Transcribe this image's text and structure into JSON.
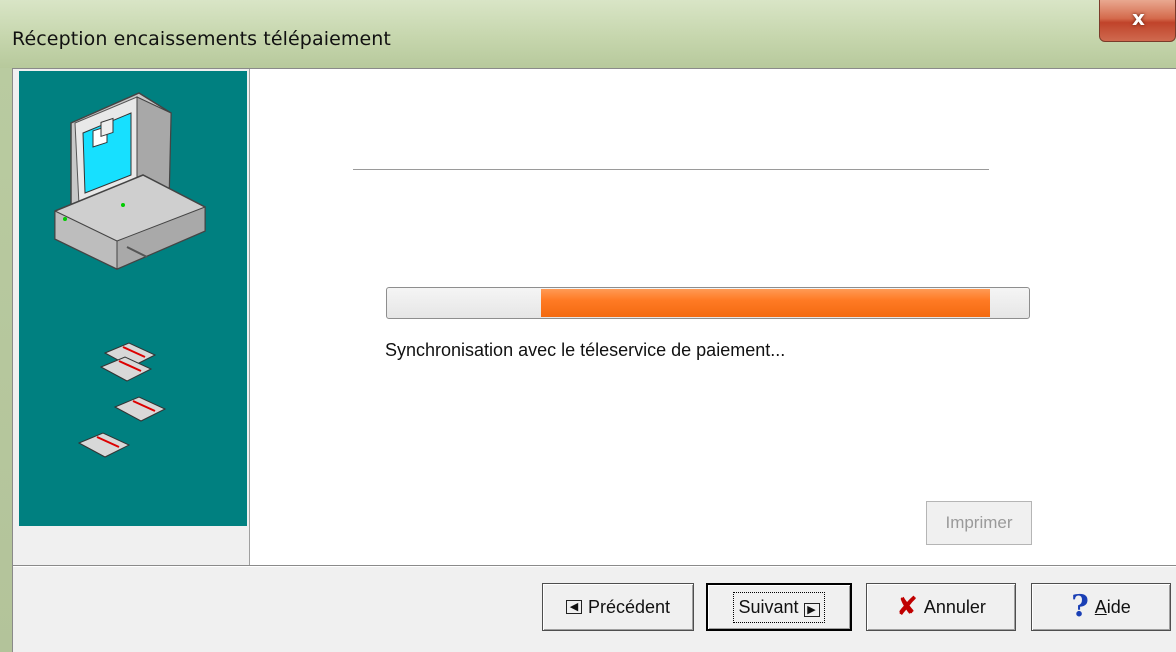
{
  "window": {
    "title": "Réception encaissements télépaiement",
    "close_glyph": "x"
  },
  "main": {
    "progress_fraction_start": 0.24,
    "progress_fraction_end": 0.94,
    "status_text": "Synchronisation avec le téleservice de paiement...",
    "print_label": "Imprimer"
  },
  "footer": {
    "prev_label": "Précédent",
    "next_label": "Suivant",
    "cancel_label": "Annuler",
    "help_label_underlined": "A",
    "help_label_rest": "ide"
  },
  "colors": {
    "sidebar": "#008080",
    "progress_fill": "#ff7a24",
    "cancel_icon": "#c00000",
    "help_icon": "#1a3fb5"
  },
  "icons": {
    "computer": "computer-icon",
    "disks": "floppy-disk-icon",
    "prev": "arrow-left-icon",
    "next": "arrow-right-icon",
    "cancel": "red-x-icon",
    "help": "question-mark-icon"
  }
}
